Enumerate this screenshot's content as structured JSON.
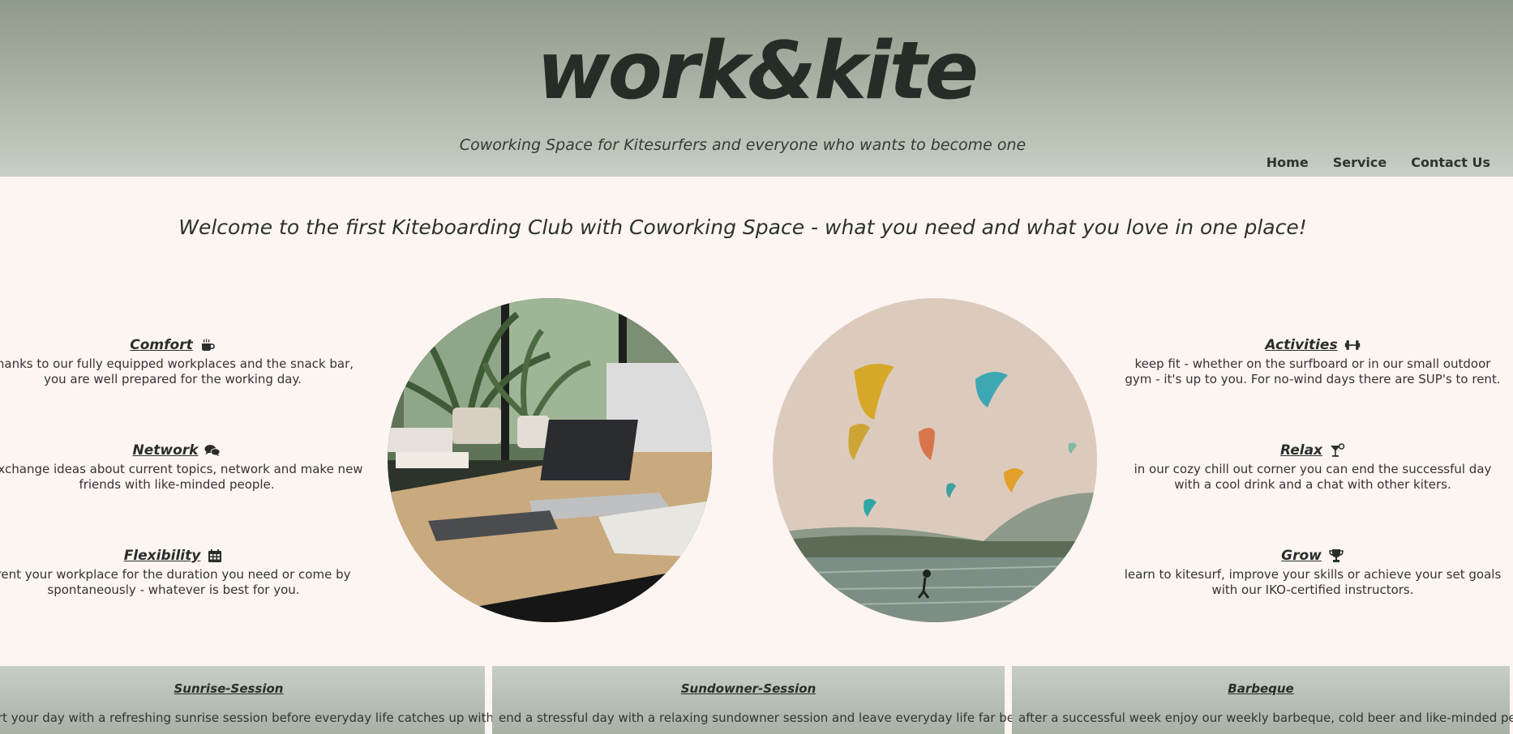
{
  "header": {
    "logo": "work&kite",
    "tagline": "Coworking Space for Kitesurfers and everyone who wants to become one"
  },
  "nav": {
    "items": [
      "Home",
      "Service",
      "Contact Us"
    ]
  },
  "welcome": "Welcome to the first Kiteboarding Club with Coworking Space - what you need and what you love in one place!",
  "features_left": [
    {
      "title": "Comfort",
      "icon": "coffee-icon",
      "text": "thanks to our fully equipped workplaces and the snack bar, you are well prepared for the working day."
    },
    {
      "title": "Network",
      "icon": "chat-bubbles-icon",
      "text": "exchange ideas about current topics, network and make new friends with like-minded people."
    },
    {
      "title": "Flexibility",
      "icon": "calendar-icon",
      "text": "rent your workplace for the duration you need or come by spontaneously - whatever is best for you."
    }
  ],
  "features_right": [
    {
      "title": "Activities",
      "icon": "dumbbell-icon",
      "text": "keep fit - whether on the surfboard or in our small outdoor gym - it's up to you. For no-wind days there are SUP's to rent."
    },
    {
      "title": "Relax",
      "icon": "cocktail-icon",
      "text": "in our cozy chill out corner you can end the successful day with a cool drink and a chat with other kiters."
    },
    {
      "title": "Grow",
      "icon": "trophy-icon",
      "text": "learn to kitesurf, improve your skills or achieve your set goals with our IKO-certified instructors."
    }
  ],
  "images": {
    "workspace": "workspace-photo",
    "kites": "kitesurfing-photo"
  },
  "sessions": [
    {
      "title": "Sunrise-Session",
      "text": "start your day with a refreshing sunrise session before everyday life catches up with you."
    },
    {
      "title": "Sundowner-Session",
      "text": "end a stressful day with a relaxing sundowner session and leave everyday life far behind."
    },
    {
      "title": "Barbeque",
      "text": "after a successful week enjoy our weekly barbeque, cold beer and like-minded people."
    }
  ],
  "colors": {
    "header_top": "#8e9a8a",
    "header_bottom": "#c7cec3",
    "background": "#fdf5f1",
    "text": "#2a2d28"
  }
}
